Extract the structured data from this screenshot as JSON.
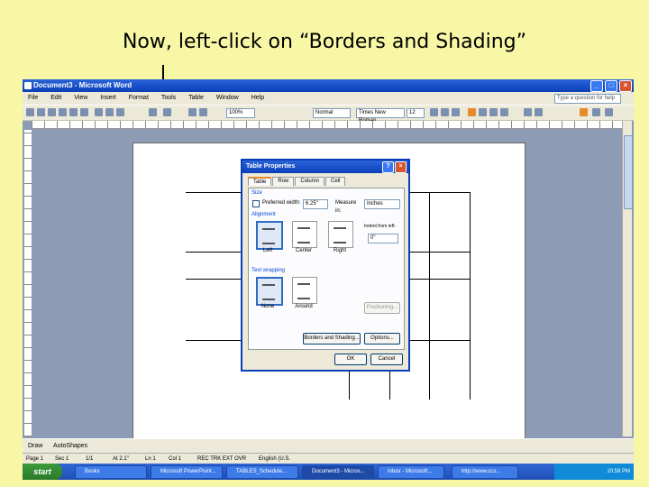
{
  "slide": {
    "title": "Now, left-click on “Borders and Shading”"
  },
  "window": {
    "title": "Document3 - Microsoft Word"
  },
  "menu": {
    "items": [
      "File",
      "Edit",
      "View",
      "Insert",
      "Format",
      "Tools",
      "Table",
      "Window",
      "Help"
    ],
    "help_box": "Type a question for help"
  },
  "toolbar": {
    "zoom": "100%",
    "style": "Normal",
    "font": "Times New Roman",
    "font_size": "12"
  },
  "dialog": {
    "title": "Table Properties",
    "tabs": [
      "Table",
      "Row",
      "Column",
      "Cell"
    ],
    "size_group": "Size",
    "preferred_width_label": "Preferred width:",
    "preferred_width_value": "6.25\"",
    "measure_in_label": "Measure in:",
    "measure_in_value": "Inches",
    "alignment_group": "Alignment",
    "alignment_options": [
      "Left",
      "Center",
      "Right"
    ],
    "indent_label": "Indent from left:",
    "indent_value": "0\"",
    "text_wrapping_group": "Text wrapping",
    "wrapping_options": [
      "None",
      "Around"
    ],
    "positioning_button": "Positioning...",
    "borders_button": "Borders and Shading...",
    "options_button": "Options...",
    "ok_button": "OK",
    "cancel_button": "Cancel"
  },
  "status": {
    "page": "Page 1",
    "sec": "Sec 1",
    "pages": "1/1",
    "at": "At 2.1\"",
    "ln": "Ln 1",
    "col": "Col 1",
    "modes": "REC TRK EXT OVR",
    "lang": "English (U.S."
  },
  "drawbar": {
    "draw_label": "Draw",
    "autoshapes_label": "AutoShapes"
  },
  "taskbar": {
    "start_label": "start",
    "items": [
      "Books",
      "Microsoft PowerPoint...",
      "TABLES_Schedule...",
      "Document3 - Micros...",
      "Inbox - Microsoft...",
      "http://www.ccs..."
    ],
    "clock": "10:59 PM"
  },
  "colors": {
    "slide_bg": "#f7f7a6",
    "xp_blue": "#0a3fb8",
    "start_green": "#3c9a3c"
  }
}
